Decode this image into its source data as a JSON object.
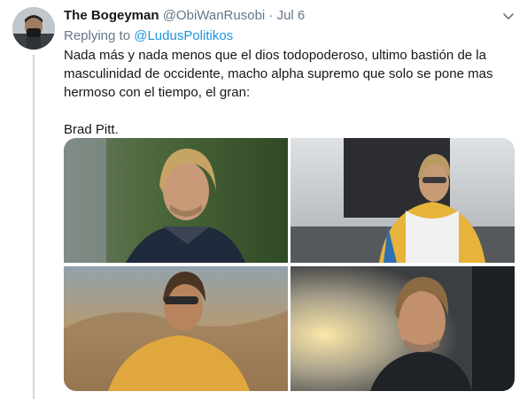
{
  "tweet": {
    "author_name": "The Bogeyman",
    "author_handle": "@ObiWanRusobi",
    "separator": "·",
    "date": "Jul 6",
    "replying_prefix": "Replying to",
    "replying_to": "@LudusPolitikos",
    "paragraphs": [
      "Nada más y nada menos que el dios todopoderoso, ultimo bastión de la masculinidad de occidente, macho alpha supremo que solo se pone mas hermoso con el tiempo, el gran:",
      "Brad Pitt."
    ]
  },
  "media": {
    "count": 4
  },
  "colors": {
    "link": "#1b95e0",
    "secondary_text": "#657786",
    "thread_line": "#ccd6dd"
  },
  "icons": {
    "menu": "chevron-down-icon"
  }
}
